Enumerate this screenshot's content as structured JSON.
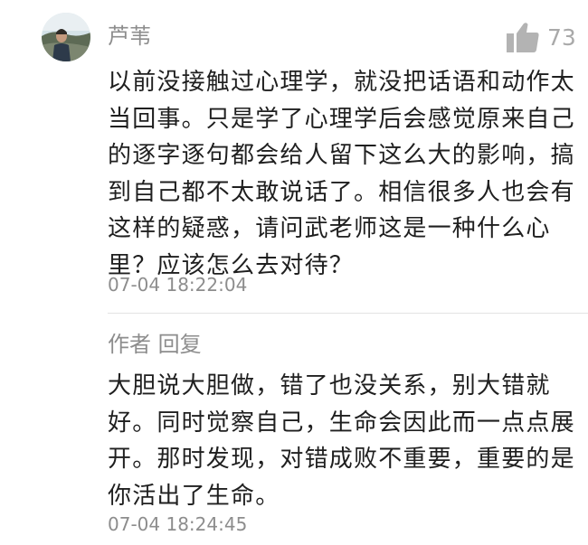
{
  "comment": {
    "author": "芦苇",
    "likes": "73",
    "text": "以前没接触过心理学，就没把话语和动作太当回事。只是学了心理学后会感觉原来自己的逐字逐句都会给人留下这么大的影响，搞到自己都不太敢说话了。相信很多人也会有这样的疑惑，请问武老师这是一种什么心里？应该怎么去对待？",
    "time": "07-04 18:22:04"
  },
  "reply": {
    "header": "作者 回复",
    "text": "大胆说大胆做，错了也没关系，别大错就好。同时觉察自己，生命会因此而一点点展开。那时发现，对错成败不重要，重要的是你活出了生命。",
    "time": "07-04 18:24:45"
  },
  "icons": {
    "like": "thumbs-up-icon",
    "avatar": "user-avatar"
  },
  "colors": {
    "meta_text": "#8d8d8d",
    "body_text": "#1f1f1f",
    "like_icon": "#b3b3b3"
  }
}
